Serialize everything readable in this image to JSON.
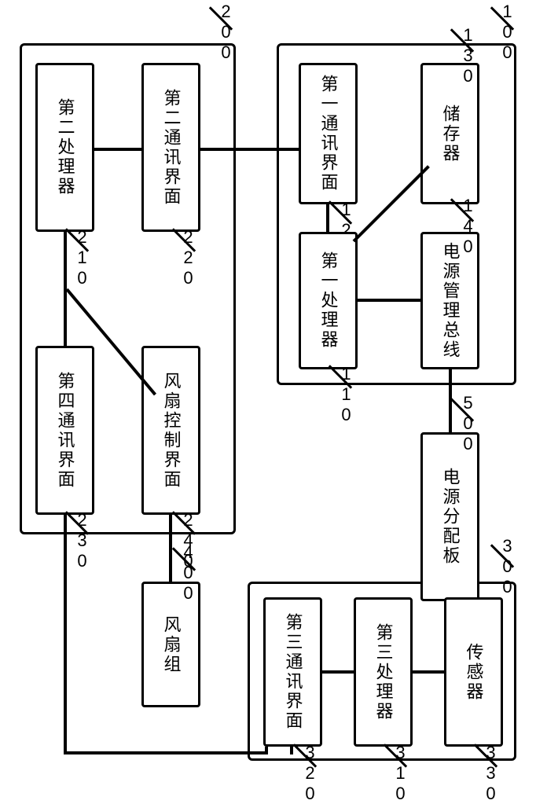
{
  "containers": {
    "c100": {
      "label": "100"
    },
    "c200": {
      "label": "200"
    },
    "c300": {
      "label": "300"
    }
  },
  "blocks": {
    "b110": {
      "text": "第一处理器",
      "label": "110"
    },
    "b120": {
      "text": "第一通讯界面",
      "label": "120"
    },
    "b130": {
      "text": "储存器",
      "label": "130"
    },
    "b140": {
      "text": "电源管理总线",
      "label": "140"
    },
    "b210": {
      "text": "第二处理器",
      "label": "210"
    },
    "b220": {
      "text": "第二通讯界面",
      "label": "220"
    },
    "b230": {
      "text": "第四通讯界面",
      "label": "230"
    },
    "b240": {
      "text": "风扇控制界面",
      "label": "240"
    },
    "b310": {
      "text": "第三处理器",
      "label": "310"
    },
    "b320": {
      "text": "第三通讯界面",
      "label": "320"
    },
    "b330": {
      "text": "传感器",
      "label": "330"
    },
    "b400": {
      "text": "风扇组",
      "label": "400"
    },
    "b500": {
      "text": "电源分配板",
      "label": "500"
    }
  }
}
